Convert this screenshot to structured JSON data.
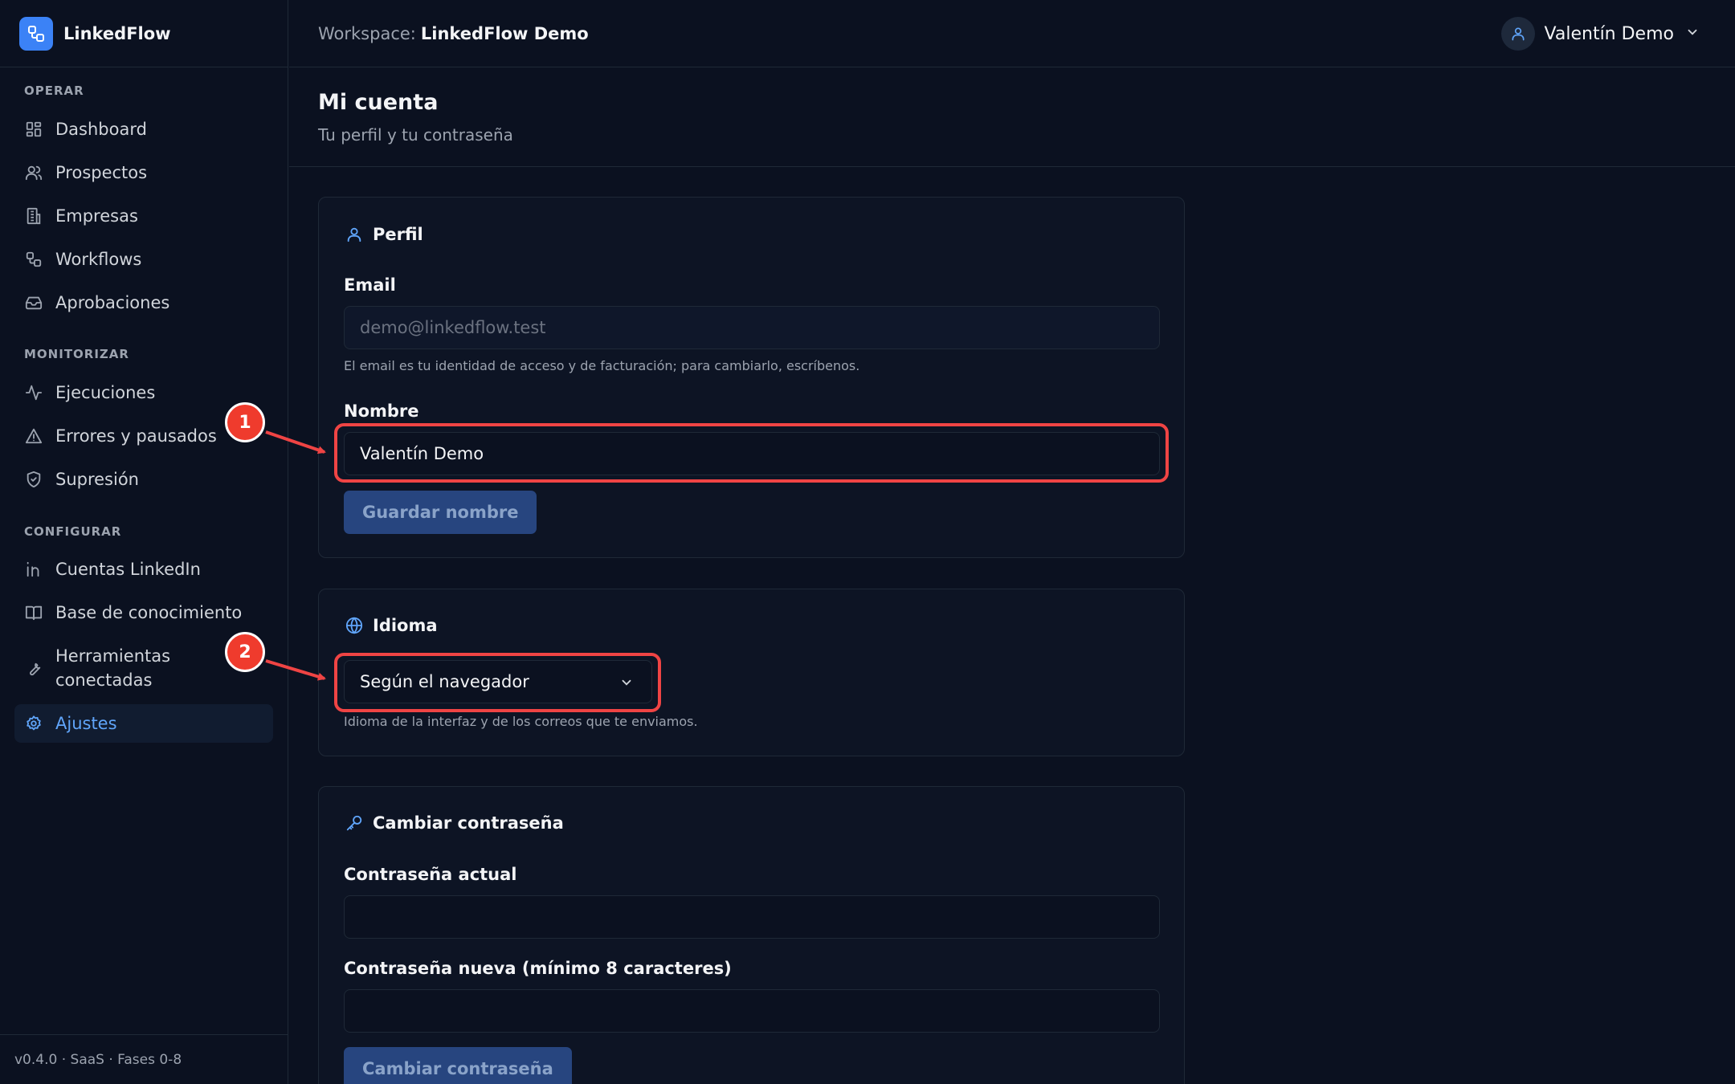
{
  "brand": {
    "name": "LinkedFlow"
  },
  "sidebar": {
    "sections": [
      {
        "label": "OPERAR"
      },
      {
        "label": "MONITORIZAR"
      },
      {
        "label": "CONFIGURAR"
      }
    ],
    "items": [
      {
        "label": "Dashboard",
        "icon": "dashboard-icon"
      },
      {
        "label": "Prospectos",
        "icon": "users-icon"
      },
      {
        "label": "Empresas",
        "icon": "building-icon"
      },
      {
        "label": "Workflows",
        "icon": "workflow-icon"
      },
      {
        "label": "Aprobaciones",
        "icon": "inbox-icon"
      },
      {
        "label": "Ejecuciones",
        "icon": "activity-icon"
      },
      {
        "label": "Errores y pausados",
        "icon": "warning-icon"
      },
      {
        "label": "Supresión",
        "icon": "shield-icon"
      },
      {
        "label": "Cuentas LinkedIn",
        "icon": "linkedin-icon"
      },
      {
        "label": "Base de conocimiento",
        "icon": "book-icon"
      },
      {
        "label": "Herramientas conectadas",
        "icon": "wrench-icon"
      },
      {
        "label": "Ajustes",
        "icon": "gear-icon",
        "active": true
      }
    ],
    "footer": "v0.4.0 · SaaS · Fases 0-8"
  },
  "topbar": {
    "workspace_label": "Workspace:",
    "workspace_name": "LinkedFlow Demo",
    "user_name": "Valentín Demo"
  },
  "page": {
    "title": "Mi cuenta",
    "subtitle": "Tu perfil y tu contraseña"
  },
  "profile": {
    "title": "Perfil",
    "email_label": "Email",
    "email_value": "demo@linkedflow.test",
    "email_help": "El email es tu identidad de acceso y de facturación; para cambiarlo, escríbenos.",
    "name_label": "Nombre",
    "name_value": "Valentín Demo",
    "save_label": "Guardar nombre"
  },
  "language": {
    "title": "Idioma",
    "selected": "Según el navegador",
    "help": "Idioma de la interfaz y de los correos que te enviamos."
  },
  "password": {
    "title": "Cambiar contraseña",
    "current_label": "Contraseña actual",
    "new_label": "Contraseña nueva (mínimo 8 caracteres)",
    "submit_label": "Cambiar contraseña"
  },
  "annotations": [
    {
      "number": "1"
    },
    {
      "number": "2"
    }
  ],
  "colors": {
    "accent": "#3b82f6",
    "background": "#0b1120",
    "annotation": "#ef4444"
  }
}
